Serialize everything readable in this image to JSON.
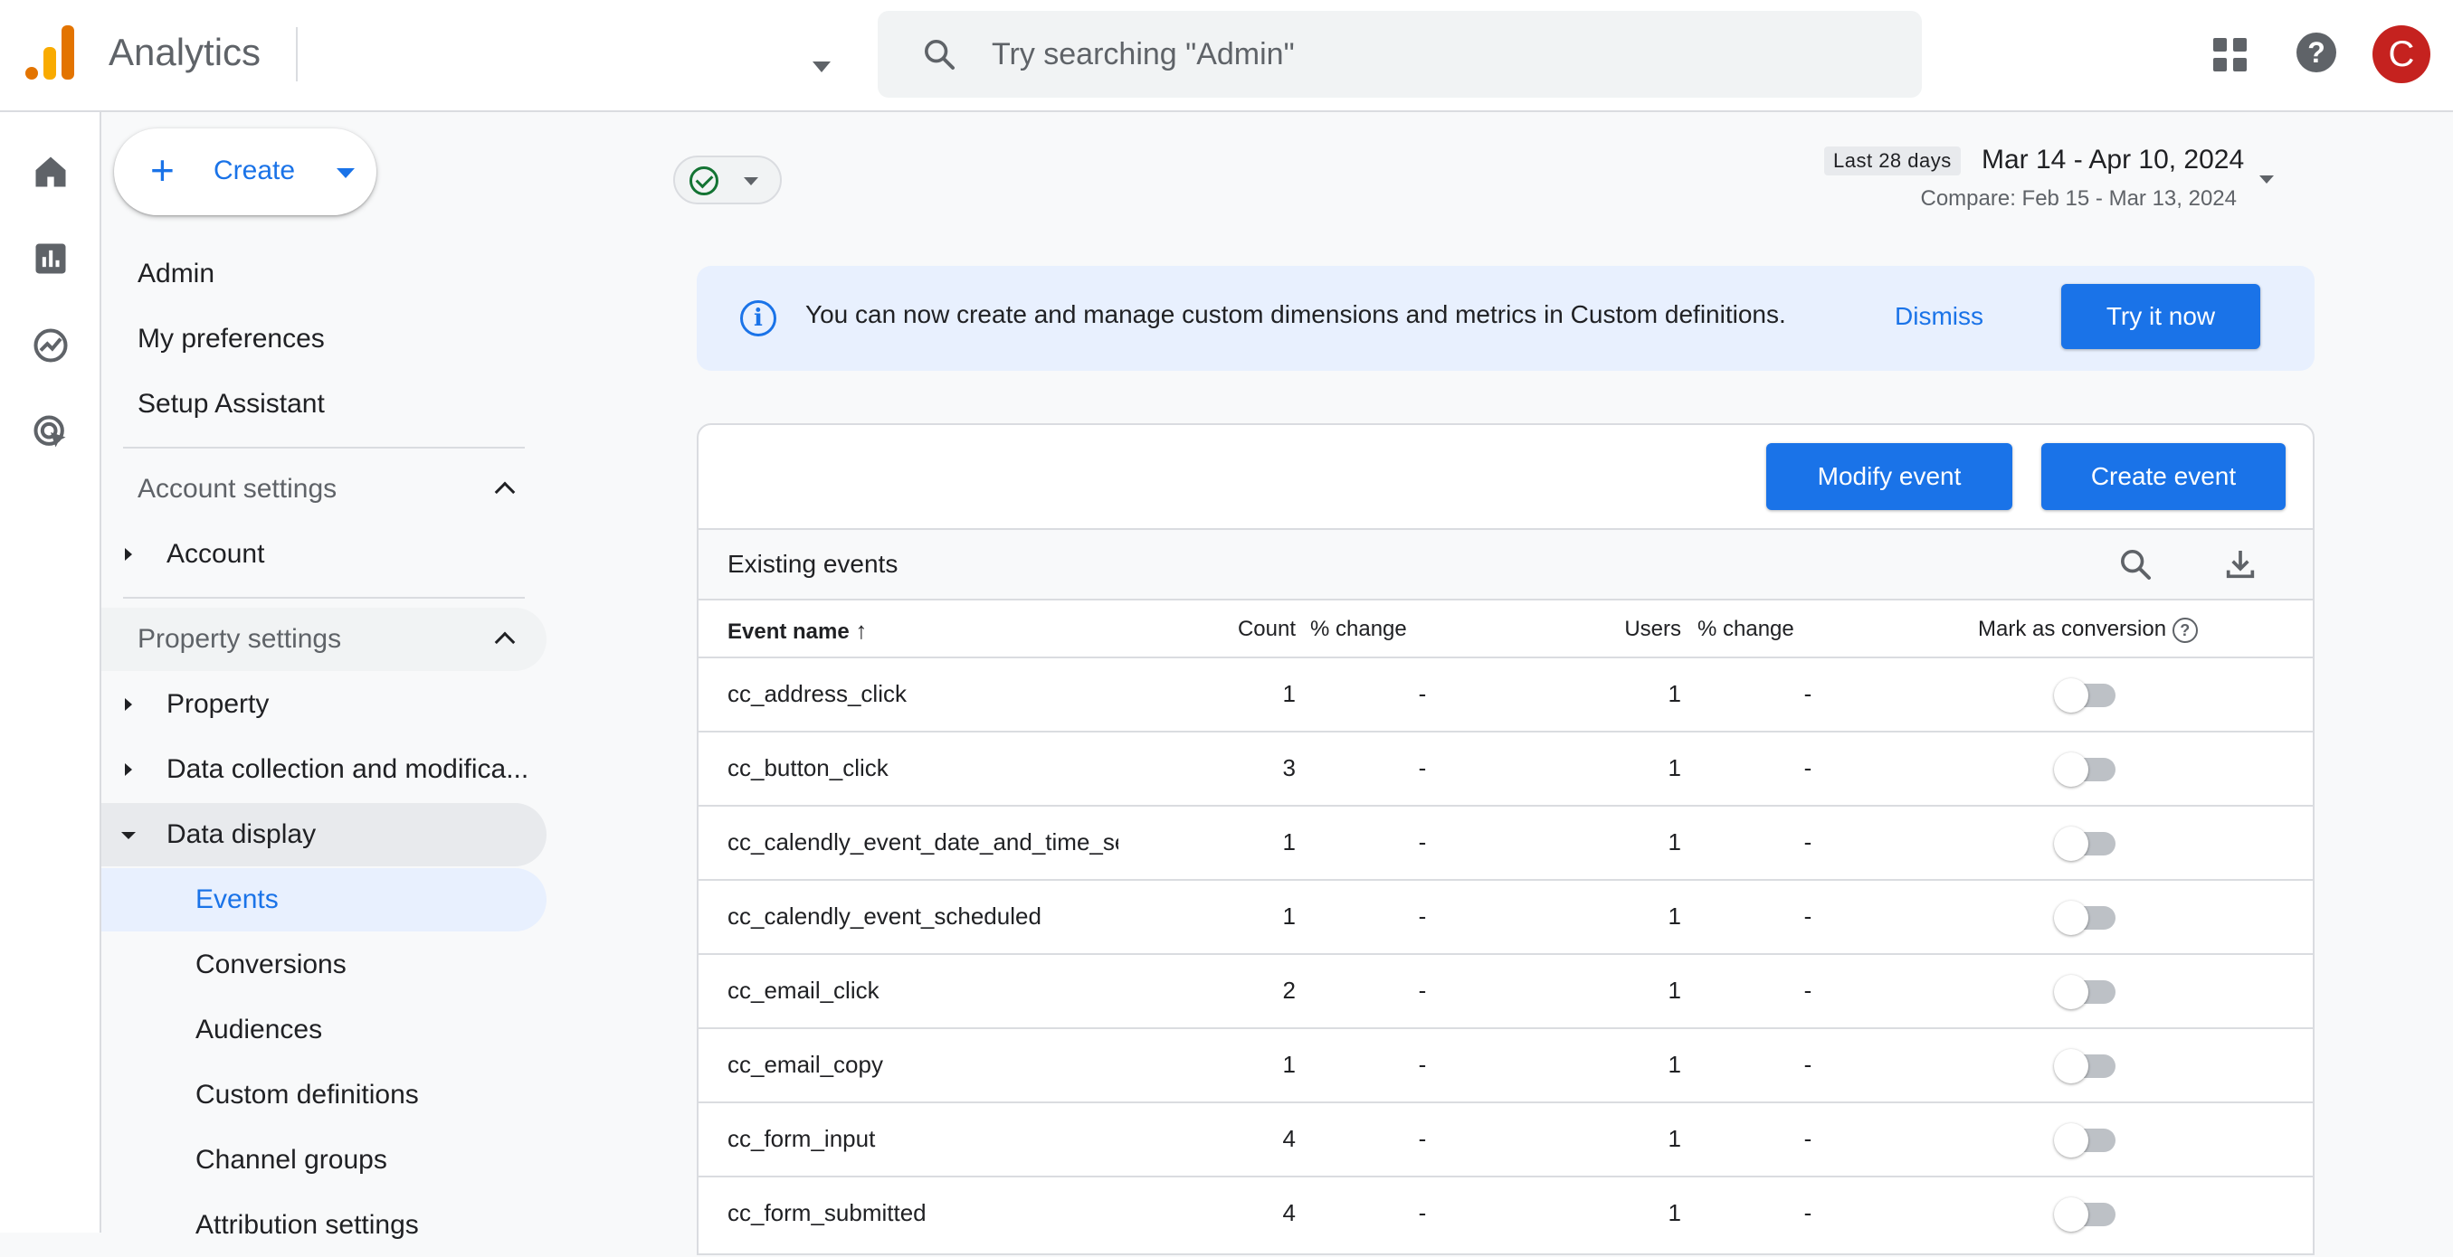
{
  "app": {
    "name": "Analytics",
    "logo_colors": [
      "#f9ab00",
      "#e37400"
    ]
  },
  "search": {
    "placeholder": "Try searching \"Admin\""
  },
  "header_icons": [
    "apps-grid-icon",
    "help-icon"
  ],
  "user": {
    "avatar_letter": "C",
    "avatar_color": "#c5221f"
  },
  "rail": [
    "home-icon",
    "reports-icon",
    "explore-icon",
    "advertising-icon"
  ],
  "sidebar": {
    "create_label": "Create",
    "top_items": [
      "Admin",
      "My preferences",
      "Setup Assistant"
    ],
    "account_settings": {
      "header": "Account settings",
      "items": [
        "Account"
      ]
    },
    "property_settings": {
      "header": "Property settings",
      "items": [
        "Property",
        "Data collection and modifica..."
      ],
      "expanded": {
        "label": "Data display",
        "children": [
          "Events",
          "Conversions",
          "Audiences",
          "Custom definitions",
          "Channel groups",
          "Attribution settings"
        ],
        "selected": "Events"
      }
    }
  },
  "date": {
    "badge": "Last 28 days",
    "range": "Mar 14 - Apr 10, 2024",
    "compare": "Compare: Feb 15 - Mar 13, 2024"
  },
  "banner": {
    "text": "You can now create and manage custom dimensions and metrics in Custom definitions.",
    "dismiss": "Dismiss",
    "cta": "Try it now"
  },
  "events_card": {
    "modify_label": "Modify event",
    "create_label": "Create event",
    "title": "Existing events",
    "columns": {
      "name": "Event name",
      "count": "Count",
      "count_change": "% change",
      "users": "Users",
      "users_change": "% change",
      "conversion": "Mark as conversion"
    },
    "rows": [
      {
        "name": "cc_address_click",
        "count": "1",
        "count_change": "-",
        "users": "1",
        "users_change": "-",
        "conversion": false
      },
      {
        "name": "cc_button_click",
        "count": "3",
        "count_change": "-",
        "users": "1",
        "users_change": "-",
        "conversion": false
      },
      {
        "name": "cc_calendly_event_date_and_time_sele",
        "count": "1",
        "count_change": "-",
        "users": "1",
        "users_change": "-",
        "conversion": false
      },
      {
        "name": "cc_calendly_event_scheduled",
        "count": "1",
        "count_change": "-",
        "users": "1",
        "users_change": "-",
        "conversion": false
      },
      {
        "name": "cc_email_click",
        "count": "2",
        "count_change": "-",
        "users": "1",
        "users_change": "-",
        "conversion": false
      },
      {
        "name": "cc_email_copy",
        "count": "1",
        "count_change": "-",
        "users": "1",
        "users_change": "-",
        "conversion": false
      },
      {
        "name": "cc_form_input",
        "count": "4",
        "count_change": "-",
        "users": "1",
        "users_change": "-",
        "conversion": false
      },
      {
        "name": "cc_form_submitted",
        "count": "4",
        "count_change": "-",
        "users": "1",
        "users_change": "-",
        "conversion": false
      }
    ]
  },
  "colors": {
    "accent": "#1a73e8",
    "selected_bg": "#e8f0fe",
    "status_ok": "#137333"
  }
}
